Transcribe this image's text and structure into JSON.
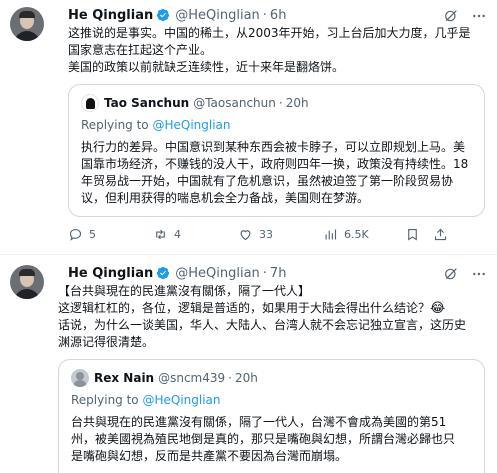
{
  "tweets": [
    {
      "author_name": "He Qinglian",
      "author_handle": "@HeQinglian",
      "time": "6h",
      "text_lines": [
        "这推说的是事实。中国的稀土，从2003年开始，习上台后加大力度，几乎是",
        "国家意志在扛起这个产业。",
        "美国的政策以前就缺乏连续性，近十来年是翻烙饼。"
      ],
      "quote": {
        "author_name": "Tao Sanchun",
        "author_handle": "@Taosanchun",
        "time": "20h",
        "replying_prefix": "Replying to ",
        "replying_to": "@HeQinglian",
        "text_lines": [
          "执行力的差异。中国意识到某种东西会被卡脖子，可以立即规划上马。美",
          "国靠市场经济，不赚钱的没人干，政府则四年一换，政策没有持续性。18",
          "年贸易战一开始，中国就有了危机意识，虽然被迫签了第一阶段贸易协",
          "议，但利用获得的喘息机会全力备战，美国则在梦游。"
        ]
      },
      "stats": {
        "replies": "5",
        "retweets": "4",
        "likes": "33",
        "views": "6.5K"
      }
    },
    {
      "author_name": "He Qinglian",
      "author_handle": "@HeQinglian",
      "time": "7h",
      "text_lines": [
        "【台共與現在的民進黨沒有關係，隔了一代人】",
        "这逻辑杠杠的，各位，逻辑是普适的，如果用于大陆会得出什么结论？",
        "话说，为什么一谈美国，华人、大陆人、台湾人就不会忘记独立宣言，这历史",
        "渊源记得很清楚。"
      ],
      "emoji": "😂",
      "quote": {
        "author_name": "Rex Nain",
        "author_handle": "@sncm439",
        "time": "20h",
        "replying_prefix": "Replying to ",
        "replying_to": "@HeQinglian",
        "text_lines": [
          "台共與現在的民進黨沒有關係，隔了一代人，台灣不會成為美國的第51",
          "州，被美國視為殖民地倒是真的，那只是嘴砲與幻想，所謂台灣必歸也只",
          "是嘴砲與幻想，反而是共產黨不要因為台灣而崩塌。"
        ]
      }
    }
  ],
  "icons": {
    "verified_color": "#1d9bf0",
    "link_color": "#1d9bf0",
    "muted_color": "#536471"
  }
}
